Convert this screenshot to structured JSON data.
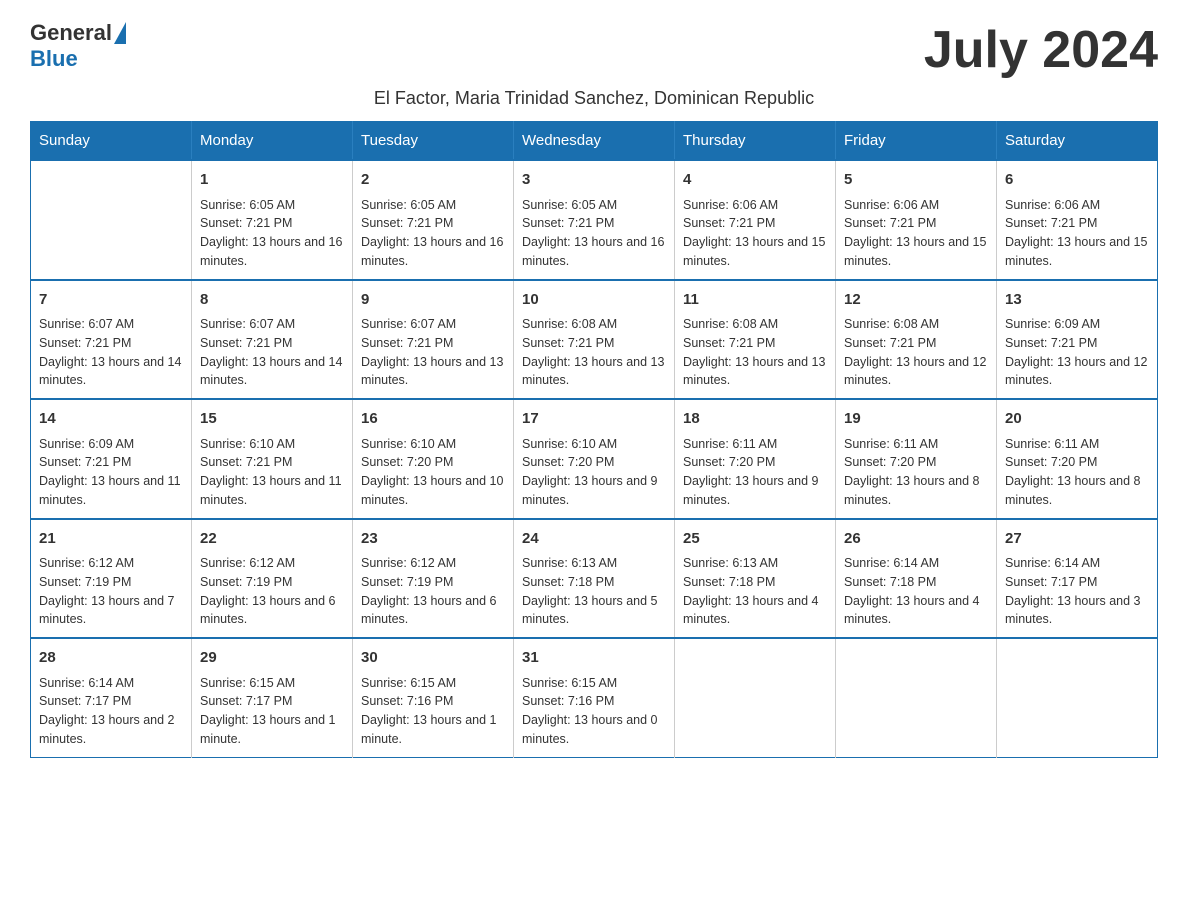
{
  "header": {
    "logo_general": "General",
    "logo_blue": "Blue",
    "month_title": "July 2024",
    "subtitle": "El Factor, Maria Trinidad Sanchez, Dominican Republic"
  },
  "days_of_week": [
    "Sunday",
    "Monday",
    "Tuesday",
    "Wednesday",
    "Thursday",
    "Friday",
    "Saturday"
  ],
  "weeks": [
    [
      {
        "day": "",
        "sunrise": "",
        "sunset": "",
        "daylight": ""
      },
      {
        "day": "1",
        "sunrise": "Sunrise: 6:05 AM",
        "sunset": "Sunset: 7:21 PM",
        "daylight": "Daylight: 13 hours and 16 minutes."
      },
      {
        "day": "2",
        "sunrise": "Sunrise: 6:05 AM",
        "sunset": "Sunset: 7:21 PM",
        "daylight": "Daylight: 13 hours and 16 minutes."
      },
      {
        "day": "3",
        "sunrise": "Sunrise: 6:05 AM",
        "sunset": "Sunset: 7:21 PM",
        "daylight": "Daylight: 13 hours and 16 minutes."
      },
      {
        "day": "4",
        "sunrise": "Sunrise: 6:06 AM",
        "sunset": "Sunset: 7:21 PM",
        "daylight": "Daylight: 13 hours and 15 minutes."
      },
      {
        "day": "5",
        "sunrise": "Sunrise: 6:06 AM",
        "sunset": "Sunset: 7:21 PM",
        "daylight": "Daylight: 13 hours and 15 minutes."
      },
      {
        "day": "6",
        "sunrise": "Sunrise: 6:06 AM",
        "sunset": "Sunset: 7:21 PM",
        "daylight": "Daylight: 13 hours and 15 minutes."
      }
    ],
    [
      {
        "day": "7",
        "sunrise": "Sunrise: 6:07 AM",
        "sunset": "Sunset: 7:21 PM",
        "daylight": "Daylight: 13 hours and 14 minutes."
      },
      {
        "day": "8",
        "sunrise": "Sunrise: 6:07 AM",
        "sunset": "Sunset: 7:21 PM",
        "daylight": "Daylight: 13 hours and 14 minutes."
      },
      {
        "day": "9",
        "sunrise": "Sunrise: 6:07 AM",
        "sunset": "Sunset: 7:21 PM",
        "daylight": "Daylight: 13 hours and 13 minutes."
      },
      {
        "day": "10",
        "sunrise": "Sunrise: 6:08 AM",
        "sunset": "Sunset: 7:21 PM",
        "daylight": "Daylight: 13 hours and 13 minutes."
      },
      {
        "day": "11",
        "sunrise": "Sunrise: 6:08 AM",
        "sunset": "Sunset: 7:21 PM",
        "daylight": "Daylight: 13 hours and 13 minutes."
      },
      {
        "day": "12",
        "sunrise": "Sunrise: 6:08 AM",
        "sunset": "Sunset: 7:21 PM",
        "daylight": "Daylight: 13 hours and 12 minutes."
      },
      {
        "day": "13",
        "sunrise": "Sunrise: 6:09 AM",
        "sunset": "Sunset: 7:21 PM",
        "daylight": "Daylight: 13 hours and 12 minutes."
      }
    ],
    [
      {
        "day": "14",
        "sunrise": "Sunrise: 6:09 AM",
        "sunset": "Sunset: 7:21 PM",
        "daylight": "Daylight: 13 hours and 11 minutes."
      },
      {
        "day": "15",
        "sunrise": "Sunrise: 6:10 AM",
        "sunset": "Sunset: 7:21 PM",
        "daylight": "Daylight: 13 hours and 11 minutes."
      },
      {
        "day": "16",
        "sunrise": "Sunrise: 6:10 AM",
        "sunset": "Sunset: 7:20 PM",
        "daylight": "Daylight: 13 hours and 10 minutes."
      },
      {
        "day": "17",
        "sunrise": "Sunrise: 6:10 AM",
        "sunset": "Sunset: 7:20 PM",
        "daylight": "Daylight: 13 hours and 9 minutes."
      },
      {
        "day": "18",
        "sunrise": "Sunrise: 6:11 AM",
        "sunset": "Sunset: 7:20 PM",
        "daylight": "Daylight: 13 hours and 9 minutes."
      },
      {
        "day": "19",
        "sunrise": "Sunrise: 6:11 AM",
        "sunset": "Sunset: 7:20 PM",
        "daylight": "Daylight: 13 hours and 8 minutes."
      },
      {
        "day": "20",
        "sunrise": "Sunrise: 6:11 AM",
        "sunset": "Sunset: 7:20 PM",
        "daylight": "Daylight: 13 hours and 8 minutes."
      }
    ],
    [
      {
        "day": "21",
        "sunrise": "Sunrise: 6:12 AM",
        "sunset": "Sunset: 7:19 PM",
        "daylight": "Daylight: 13 hours and 7 minutes."
      },
      {
        "day": "22",
        "sunrise": "Sunrise: 6:12 AM",
        "sunset": "Sunset: 7:19 PM",
        "daylight": "Daylight: 13 hours and 6 minutes."
      },
      {
        "day": "23",
        "sunrise": "Sunrise: 6:12 AM",
        "sunset": "Sunset: 7:19 PM",
        "daylight": "Daylight: 13 hours and 6 minutes."
      },
      {
        "day": "24",
        "sunrise": "Sunrise: 6:13 AM",
        "sunset": "Sunset: 7:18 PM",
        "daylight": "Daylight: 13 hours and 5 minutes."
      },
      {
        "day": "25",
        "sunrise": "Sunrise: 6:13 AM",
        "sunset": "Sunset: 7:18 PM",
        "daylight": "Daylight: 13 hours and 4 minutes."
      },
      {
        "day": "26",
        "sunrise": "Sunrise: 6:14 AM",
        "sunset": "Sunset: 7:18 PM",
        "daylight": "Daylight: 13 hours and 4 minutes."
      },
      {
        "day": "27",
        "sunrise": "Sunrise: 6:14 AM",
        "sunset": "Sunset: 7:17 PM",
        "daylight": "Daylight: 13 hours and 3 minutes."
      }
    ],
    [
      {
        "day": "28",
        "sunrise": "Sunrise: 6:14 AM",
        "sunset": "Sunset: 7:17 PM",
        "daylight": "Daylight: 13 hours and 2 minutes."
      },
      {
        "day": "29",
        "sunrise": "Sunrise: 6:15 AM",
        "sunset": "Sunset: 7:17 PM",
        "daylight": "Daylight: 13 hours and 1 minute."
      },
      {
        "day": "30",
        "sunrise": "Sunrise: 6:15 AM",
        "sunset": "Sunset: 7:16 PM",
        "daylight": "Daylight: 13 hours and 1 minute."
      },
      {
        "day": "31",
        "sunrise": "Sunrise: 6:15 AM",
        "sunset": "Sunset: 7:16 PM",
        "daylight": "Daylight: 13 hours and 0 minutes."
      },
      {
        "day": "",
        "sunrise": "",
        "sunset": "",
        "daylight": ""
      },
      {
        "day": "",
        "sunrise": "",
        "sunset": "",
        "daylight": ""
      },
      {
        "day": "",
        "sunrise": "",
        "sunset": "",
        "daylight": ""
      }
    ]
  ],
  "colors": {
    "header_bg": "#1a6faf",
    "border": "#1a6faf",
    "accent": "#1a6faf"
  }
}
